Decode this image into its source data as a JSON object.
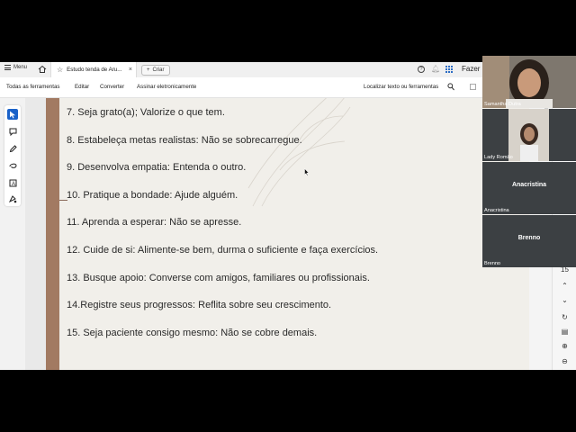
{
  "tabbar": {
    "menu_label": "Menu",
    "tab_title": "Estudo tenda de Aru...",
    "create_label": "Criar",
    "right_label": "Fazer"
  },
  "toolbar": {
    "all_tools": "Todas as ferramentas",
    "edit": "Editar",
    "convert": "Converter",
    "sign": "Assinar eletronicamente",
    "search_placeholder": "Localizar texto ou ferramentas"
  },
  "document": {
    "lines": [
      "7. Seja grato(a); Valorize o que tem.",
      "8. Estabeleça metas realistas: Não se sobrecarregue.",
      "9. Desenvolva empatia: Entenda o outro.",
      "10. Pratique a bondade: Ajude alguém.",
      "11. Aprenda a esperar: Não se apresse.",
      "12. Cuide de si: Alimente-se bem, durma o suficiente e faça exercícios.",
      "13. Busque apoio: Converse com amigos, familiares ou profissionais.",
      "14.Registre seus progressos: Reflita sobre seu crescimento.",
      "15.  Seja paciente consigo mesmo: Não se cobre demais."
    ]
  },
  "right_rail": {
    "page_number": "15"
  },
  "participants": [
    {
      "name": "Samantha Dutra"
    },
    {
      "name": "Lady Romão"
    },
    {
      "name": "Anacristina",
      "label": "Anacristina"
    },
    {
      "name": "Brenno",
      "label": "Brenno"
    }
  ],
  "colors": {
    "accent": "#1a62c9",
    "page_strip": "#a27a62",
    "tile_bg": "#3c4043"
  }
}
